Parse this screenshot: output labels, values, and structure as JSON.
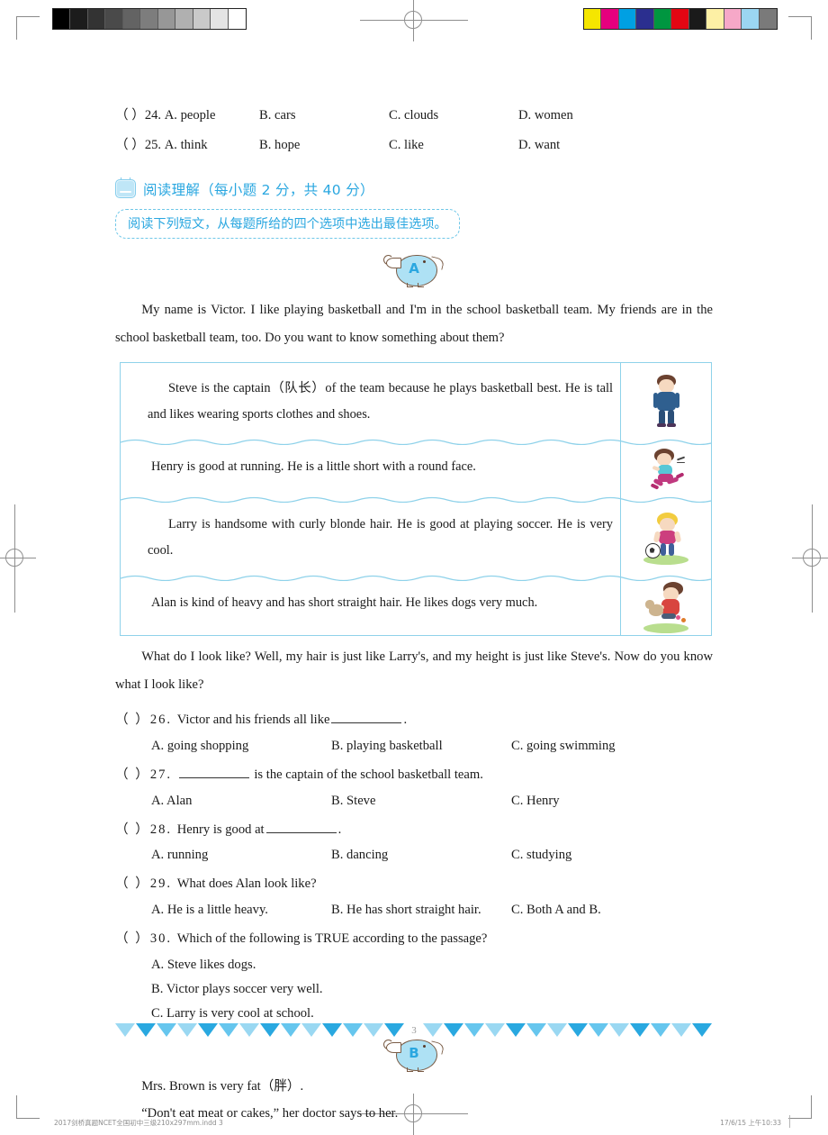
{
  "print_marks": {
    "grayscale_bar": [
      "#000000",
      "#1c1c1c",
      "#333333",
      "#4a4a4a",
      "#636363",
      "#7d7d7d",
      "#979797",
      "#b0b0b0",
      "#c9c9c9",
      "#e4e4e4",
      "#ffffff"
    ],
    "color_bar": [
      "#f5e600",
      "#e6007e",
      "#00a0e3",
      "#2b2f8f",
      "#009640",
      "#e30613",
      "#1a1a1a",
      "#fdf0a5",
      "#f6a8c8",
      "#9bd6f2",
      "#7a7a7a"
    ],
    "registration_icon": "registration-crosshair"
  },
  "cloze": {
    "rows": [
      {
        "stem": "（  ）24. A. people",
        "b": "B. cars",
        "c": "C. clouds",
        "d": "D. women"
      },
      {
        "stem": "（  ）25. A. think",
        "b": "B. hope",
        "c": "C. like",
        "d": "D. want"
      }
    ]
  },
  "section": {
    "badge_label": "三",
    "title": "阅读理解（每小题 2 分，共 40 分）",
    "instruction": "阅读下列短文，从每题所给的四个选项中选出最佳选项。"
  },
  "passage_a": {
    "marker_letter": "A",
    "intro": "My name is Victor. I like playing basketball and I'm in the school basketball team. My friends are in the school basketball team, too. Do you want to know something about them?",
    "rows": [
      {
        "text": "Steve is the captain（队长）of the team because he plays basketball best. He is tall and likes wearing sports clothes and shoes.",
        "figure": "boy-standing-suit"
      },
      {
        "text": "Henry is good at running. He is a little short with a round face.",
        "figure": "boy-running"
      },
      {
        "text": "Larry is handsome with curly blonde hair. He is good at playing soccer. He is very cool.",
        "figure": "boy-soccer-blonde"
      },
      {
        "text": "Alan is kind of heavy and has short straight hair. He likes dogs very much.",
        "figure": "boy-with-dog"
      }
    ],
    "outro": "What do I look like? Well, my hair is just like Larry's, and my height is just like Steve's. Now do you know what I look like?"
  },
  "questions": [
    {
      "number": "（  ）26.",
      "stem_before": "Victor and his friends all like",
      "stem_after": ".",
      "has_blank": true,
      "blank_position": "middle",
      "layout": "row",
      "options": [
        "A. going shopping",
        "B. playing basketball",
        "C. going swimming"
      ]
    },
    {
      "number": "（  ）27.",
      "stem_before": "",
      "stem_after": "is the captain of the school basketball team.",
      "has_blank": true,
      "blank_position": "start",
      "layout": "row",
      "options": [
        "A. Alan",
        "B. Steve",
        "C. Henry"
      ]
    },
    {
      "number": "（  ）28.",
      "stem_before": "Henry is good at",
      "stem_after": ".",
      "has_blank": true,
      "blank_position": "middle",
      "layout": "row",
      "options": [
        "A. running",
        "B. dancing",
        "C. studying"
      ]
    },
    {
      "number": "（  ）29.",
      "stem_before": "What does Alan look like?",
      "stem_after": "",
      "has_blank": false,
      "blank_position": "none",
      "layout": "row",
      "options": [
        "A. He is a little heavy.",
        "B. He has short straight hair.",
        "C. Both A and B."
      ]
    },
    {
      "number": "（  ）30.",
      "stem_before": "Which of the following is TRUE according to the passage?",
      "stem_after": "",
      "has_blank": false,
      "blank_position": "none",
      "layout": "stack",
      "options": [
        "A. Steve likes dogs.",
        "B. Victor plays soccer very well.",
        "C. Larry is very cool at school."
      ]
    }
  ],
  "passage_b": {
    "marker_letter": "B",
    "lines": [
      "Mrs. Brown is very fat（胖）.",
      "“Don't eat meat or cakes,” her doctor says to her."
    ]
  },
  "footer": {
    "page_number": "3",
    "bunting_color": "#4fb8e8"
  },
  "print_meta": {
    "left": "2017剑桥真题NCET全国初中三级210x297mm.indd   3",
    "right": "17/6/15   上午10:33"
  }
}
